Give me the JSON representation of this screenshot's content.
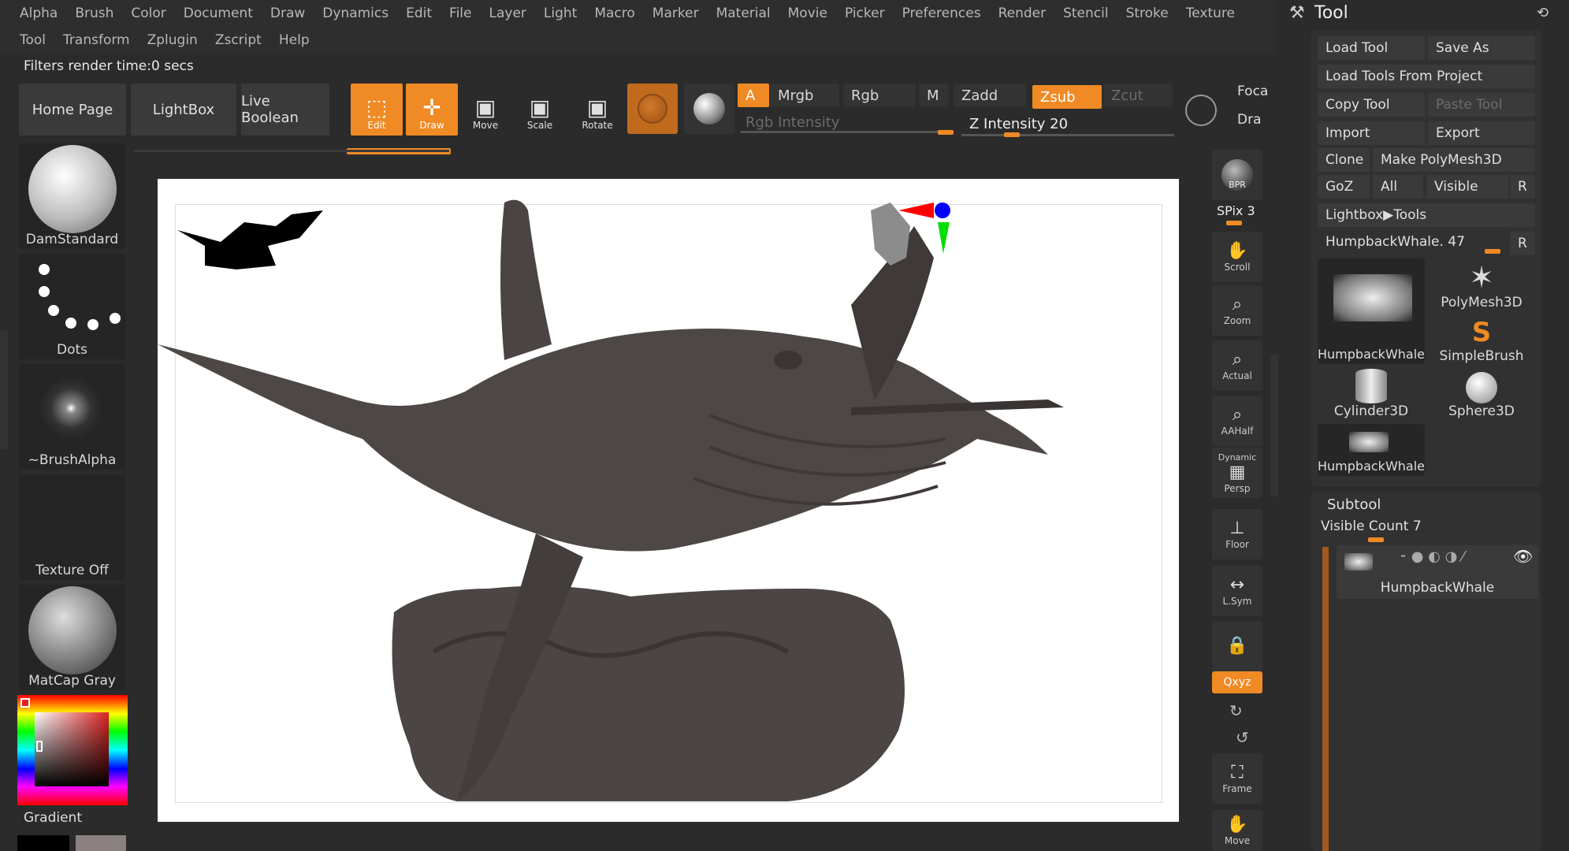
{
  "menu_row1": [
    "Alpha",
    "Brush",
    "Color",
    "Document",
    "Draw",
    "Dynamics",
    "Edit",
    "File",
    "Layer",
    "Light",
    "Macro",
    "Marker",
    "Material",
    "Movie",
    "Picker",
    "Preferences",
    "Render",
    "Stencil",
    "Stroke",
    "Texture"
  ],
  "menu_row2": [
    "Tool",
    "Transform",
    "Zplugin",
    "Zscript",
    "Help"
  ],
  "status": "Filters render time:0 secs",
  "shelf": {
    "home": "Home Page",
    "lightbox": "LightBox",
    "live_boolean": "Live Boolean",
    "edit": "Edit",
    "draw": "Draw",
    "move": "Move",
    "scale": "Scale",
    "rotate": "Rotate",
    "a": "A",
    "mrgb": "Mrgb",
    "rgb": "Rgb",
    "m": "M",
    "zadd": "Zadd",
    "zsub": "Zsub",
    "zcut": "Zcut",
    "rgb_intensity": "Rgb Intensity",
    "z_intensity": "Z Intensity 20",
    "z_intensity_value": 20,
    "focal": "Foca",
    "draw_size": "Dra"
  },
  "left": {
    "brush": "DamStandard",
    "stroke": "Dots",
    "alpha": "~BrushAlpha",
    "texture": "Texture Off",
    "material": "MatCap Gray",
    "gradient": "Gradient"
  },
  "right_shelf": {
    "bpr": "BPR",
    "spix": "SPix 3",
    "scroll": "Scroll",
    "zoom": "Zoom",
    "actual": "Actual",
    "aahalf": "AAHalf",
    "persp": "Persp",
    "persp_top": "Dynamic",
    "floor": "Floor",
    "lsym": "L.Sym",
    "xyz": "Qxyz",
    "frame": "Frame",
    "move": "Move"
  },
  "tool": {
    "title": "Tool",
    "load_tool": "Load Tool",
    "save_as": "Save As",
    "load_tools_project": "Load Tools From Project",
    "copy_tool": "Copy Tool",
    "paste_tool": "Paste Tool",
    "import": "Import",
    "export": "Export",
    "clone": "Clone",
    "make_polymesh": "Make PolyMesh3D",
    "goz": "GoZ",
    "all": "All",
    "visible": "Visible",
    "r": "R",
    "lightbox_tools": "Lightbox▶Tools",
    "current_tool": "HumpbackWhale. 47",
    "current_tool_value": 47,
    "thumbs": [
      "HumpbackWhale",
      "PolyMesh3D",
      "SimpleBrush",
      "Cylinder3D",
      "Sphere3D",
      "HumpbackWhale"
    ],
    "subtool": "Subtool",
    "visible_count": "Visible Count 7",
    "subtool_item": "HumpbackWhale"
  },
  "colors": {
    "accent": "#f08a24",
    "panel": "#3a3a3a",
    "bg": "#2b2b2b"
  }
}
